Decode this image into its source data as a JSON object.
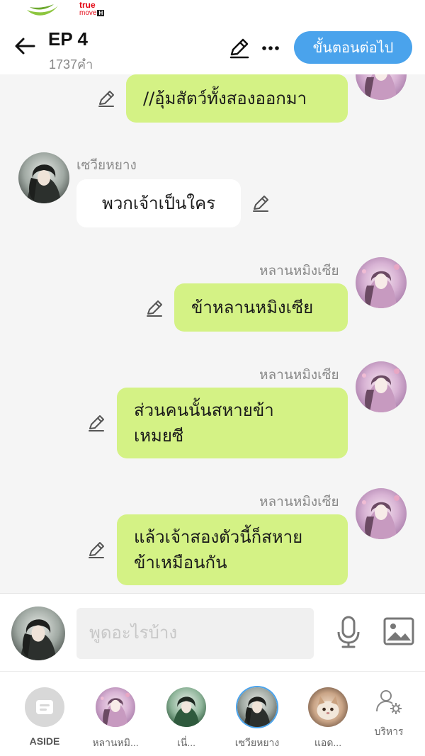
{
  "status": {
    "carrier_brand": "true",
    "carrier_sub": "move",
    "carrier_badge": "H"
  },
  "header": {
    "episode_title": "EP 4",
    "word_count": "1737คำ",
    "next_step_label": "ขั้นตอนต่อไป"
  },
  "messages": [
    {
      "side": "right",
      "sender": "",
      "text": "//อุ้มสัตว์ทั้งสองออกมา",
      "avatar": "hlan-avatar"
    },
    {
      "side": "left",
      "sender": "เซวียหยาง",
      "text": "พวกเจ้าเป็นใคร",
      "avatar": "xue-avatar"
    },
    {
      "side": "right",
      "sender": "หลานหมิงเซีย",
      "text": "ข้าหลานหมิงเซีย",
      "avatar": "hlan-avatar"
    },
    {
      "side": "right",
      "sender": "หลานหมิงเซีย",
      "text_line1": "ส่วนคนนั้นสหายข้า",
      "text_line2": "เหมยซี",
      "avatar": "hlan-avatar"
    },
    {
      "side": "right",
      "sender": "หลานหมิงเซีย",
      "text_line1": "แล้วเจ้าสองตัวนี้ก็สหาย",
      "text_line2": "ข้าเหมือนกัน",
      "avatar": "hlan-avatar"
    }
  ],
  "composer": {
    "placeholder": "พูดอะไรบ้าง"
  },
  "characters": [
    {
      "label": "ASIDE"
    },
    {
      "label": "หลานหมิ..."
    },
    {
      "label": "เนี่..."
    },
    {
      "label": "เซวียหยาง",
      "selected": true
    },
    {
      "label": "แอด..."
    },
    {
      "label": "บริหาร"
    }
  ],
  "colors": {
    "accent": "#4aa3ec",
    "bubble_right": "#d4f285",
    "bubble_left": "#ffffff",
    "background": "#f5f5f5"
  }
}
